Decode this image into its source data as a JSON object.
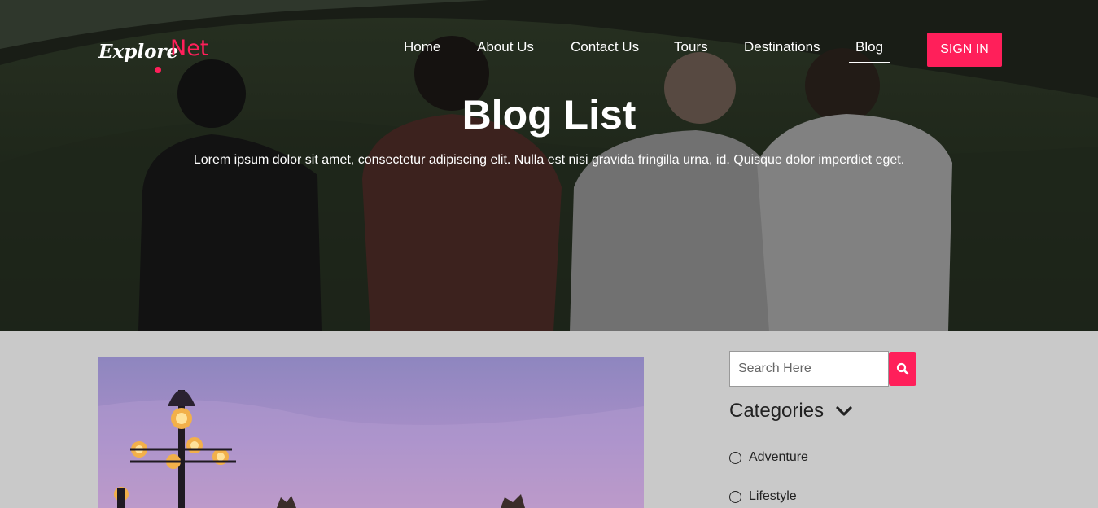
{
  "brand": {
    "word1": "Explore",
    "word2": "Net",
    "accent_color": "#ff1f5a"
  },
  "nav": {
    "items": [
      {
        "label": "Home"
      },
      {
        "label": "About Us"
      },
      {
        "label": "Contact Us"
      },
      {
        "label": "Tours"
      },
      {
        "label": "Destinations"
      },
      {
        "label": "Blog",
        "active": true
      }
    ],
    "signin_label": "SIGN IN"
  },
  "hero": {
    "title": "Blog List",
    "subtitle": "Lorem ipsum dolor sit amet, consectetur adipiscing elit. Nulla est nisi gravida fringilla urna, id. Quisque dolor imperdiet eget.",
    "image": "four friends sitting on a hill"
  },
  "post": {
    "image": "street lamps at dusk"
  },
  "sidebar": {
    "search_placeholder": "Search Here",
    "search_icon": "search-icon",
    "categories_title": "Categories",
    "categories_icon": "chevron-down-icon",
    "categories": [
      {
        "label": "Adventure"
      },
      {
        "label": "Lifestyle"
      }
    ]
  }
}
